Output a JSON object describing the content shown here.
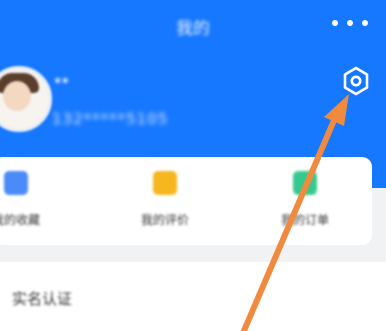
{
  "header": {
    "title": "我的"
  },
  "user": {
    "name": "**",
    "phone": "132*****5105"
  },
  "shortcuts": [
    {
      "label": "我的收藏",
      "icon": "collection-icon",
      "color": "#4a8cf7"
    },
    {
      "label": "我的评价",
      "icon": "review-icon",
      "color": "#f5b620"
    },
    {
      "label": "我的订单",
      "icon": "order-icon",
      "color": "#36c98f"
    }
  ],
  "list": {
    "first_item_label": "实名认证"
  },
  "colors": {
    "header_bg": "#1677ff",
    "annotation_arrow": "#f08a3e"
  }
}
